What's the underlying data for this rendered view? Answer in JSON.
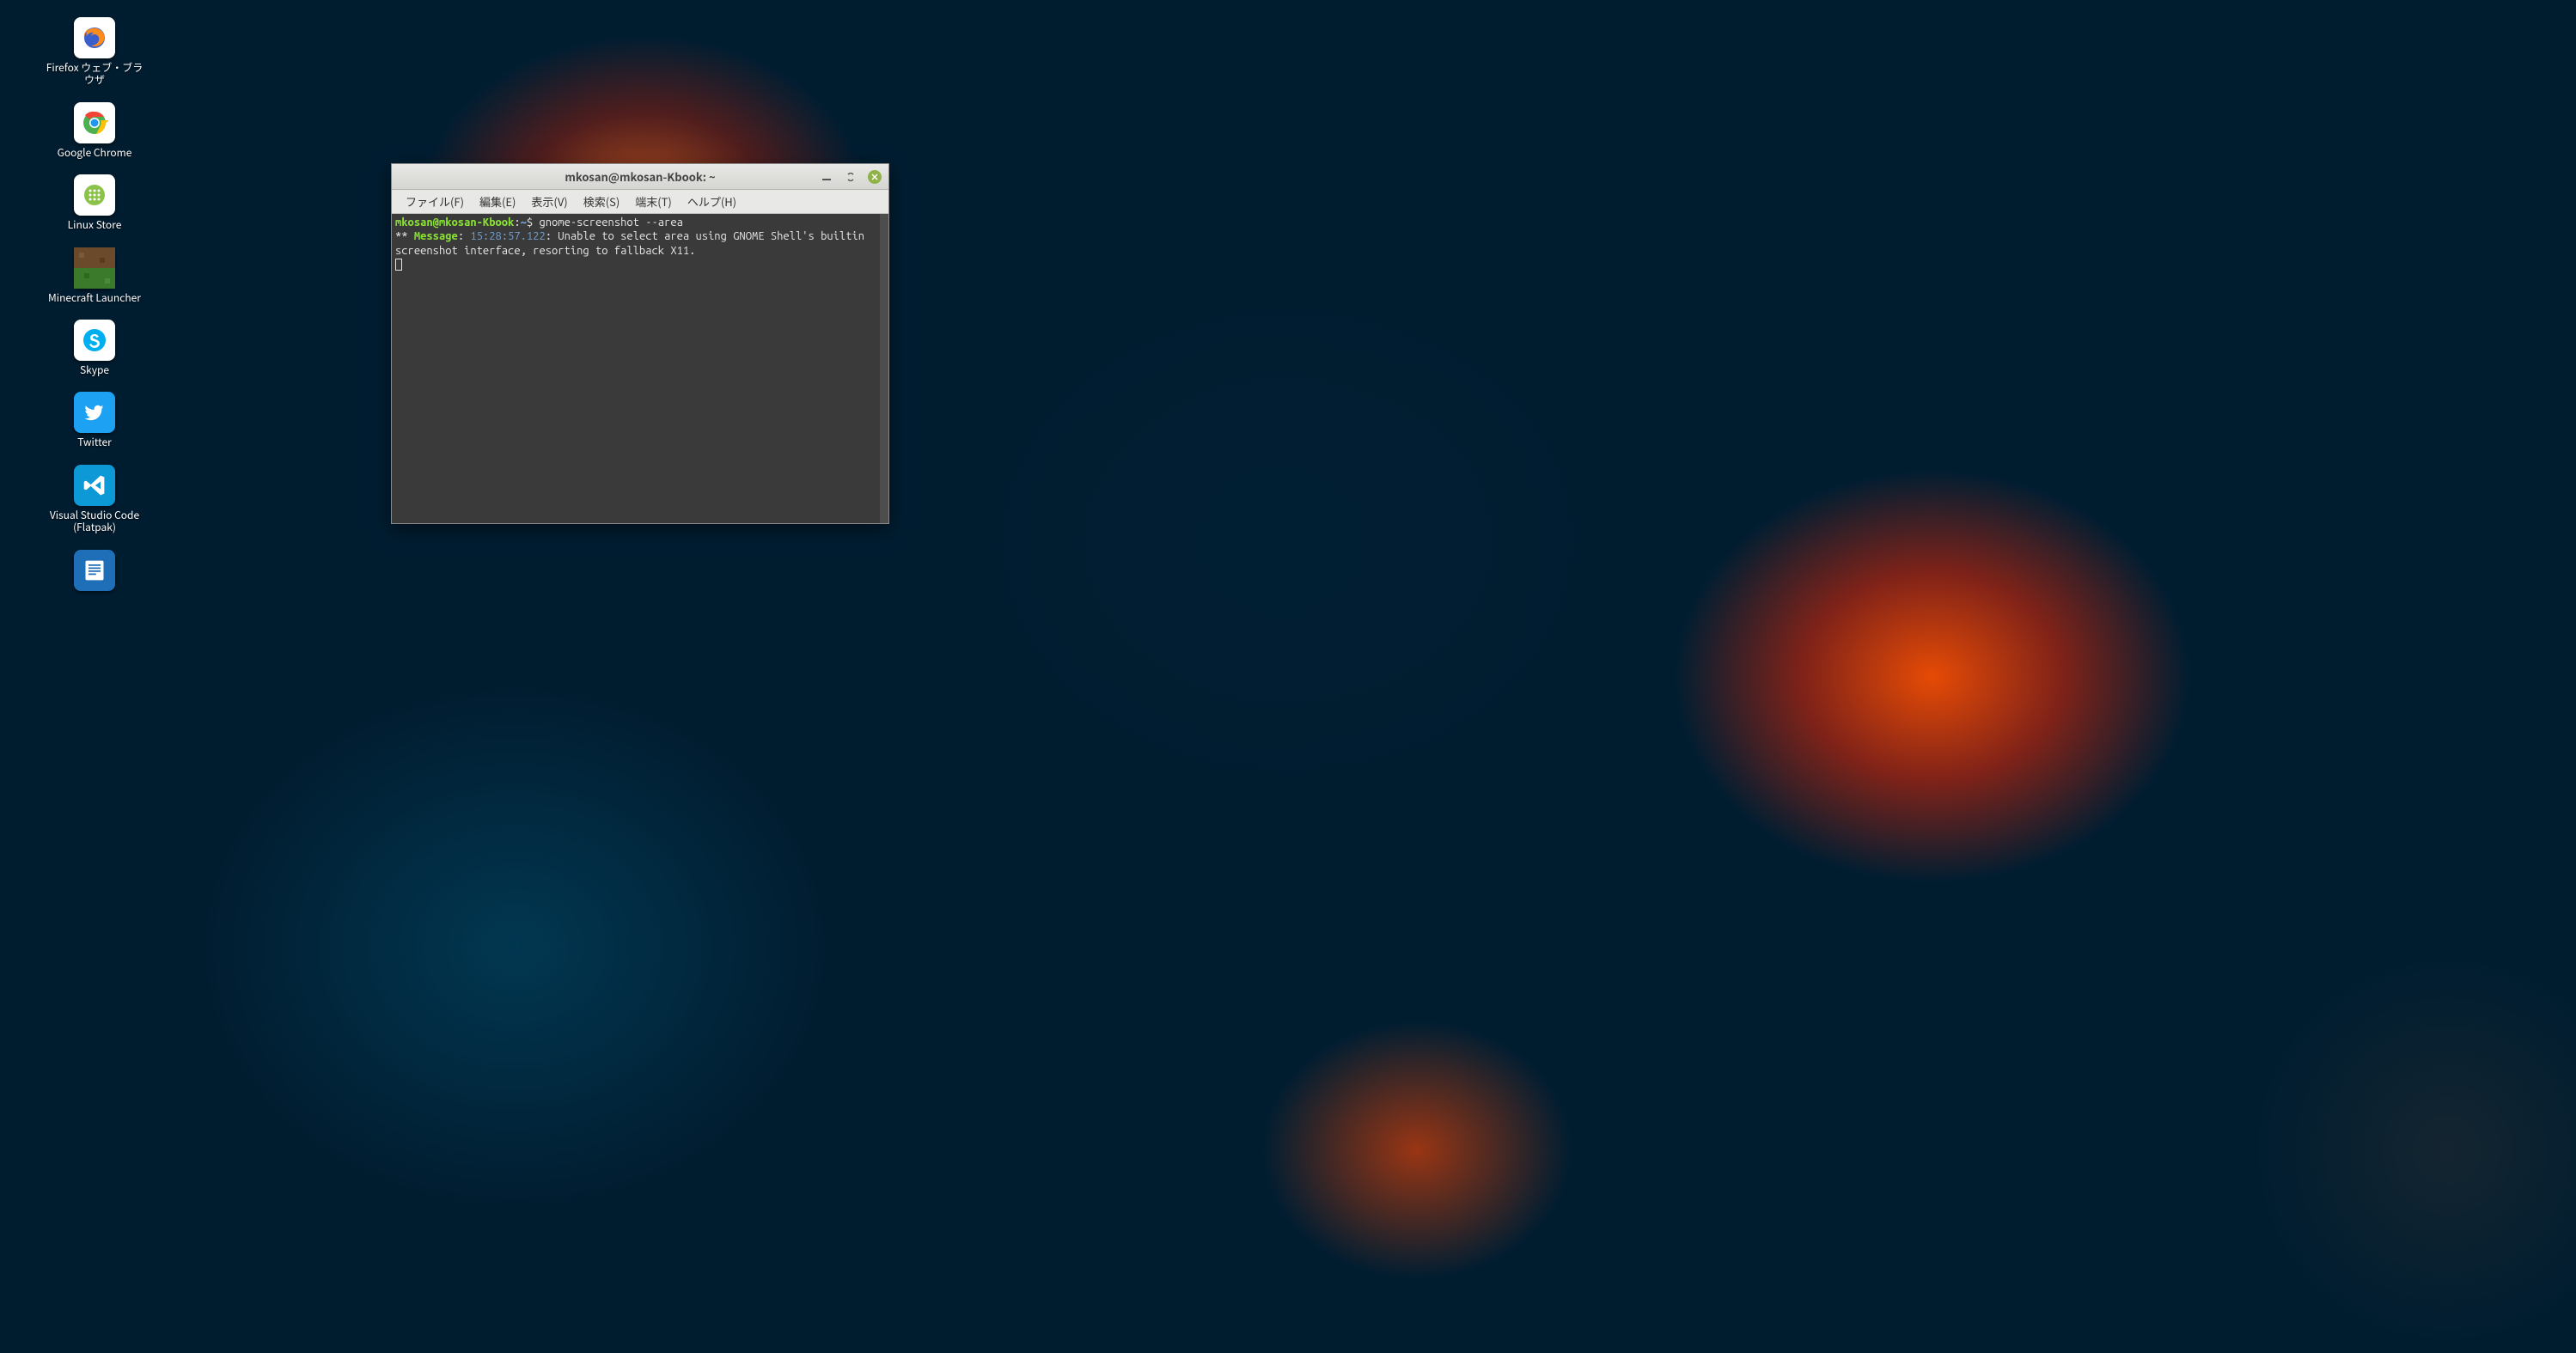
{
  "desktop": {
    "icons": [
      {
        "id": "firefox",
        "label": "Firefox ウェブ・ブラウザ"
      },
      {
        "id": "chrome",
        "label": "Google Chrome"
      },
      {
        "id": "linuxstore",
        "label": "Linux Store"
      },
      {
        "id": "minecraft",
        "label": "Minecraft Launcher"
      },
      {
        "id": "skype",
        "label": "Skype"
      },
      {
        "id": "twitter",
        "label": "Twitter"
      },
      {
        "id": "vscode",
        "label": "Visual Studio Code (Flatpak)"
      },
      {
        "id": "loffice",
        "label": ""
      }
    ]
  },
  "terminal": {
    "title": "mkosan@mkosan-Kbook: ~",
    "menus": {
      "file": "ファイル(F)",
      "edit": "編集(E)",
      "view": "表示(V)",
      "search": "検索(S)",
      "terminal": "端末(T)",
      "help": "ヘルプ(H)"
    },
    "prompt": {
      "user_host": "mkosan@mkosan-Kbook",
      "sep1": ":",
      "path": "~",
      "sep2": "$ ",
      "command": "gnome-screenshot --area"
    },
    "output": {
      "prefix": "** ",
      "tag": "Message",
      "colon": ": ",
      "timestamp": "15:28:57.122",
      "rest": ": Unable to select area using GNOME Shell's builtin screenshot interface, resorting to fallback X11."
    }
  }
}
